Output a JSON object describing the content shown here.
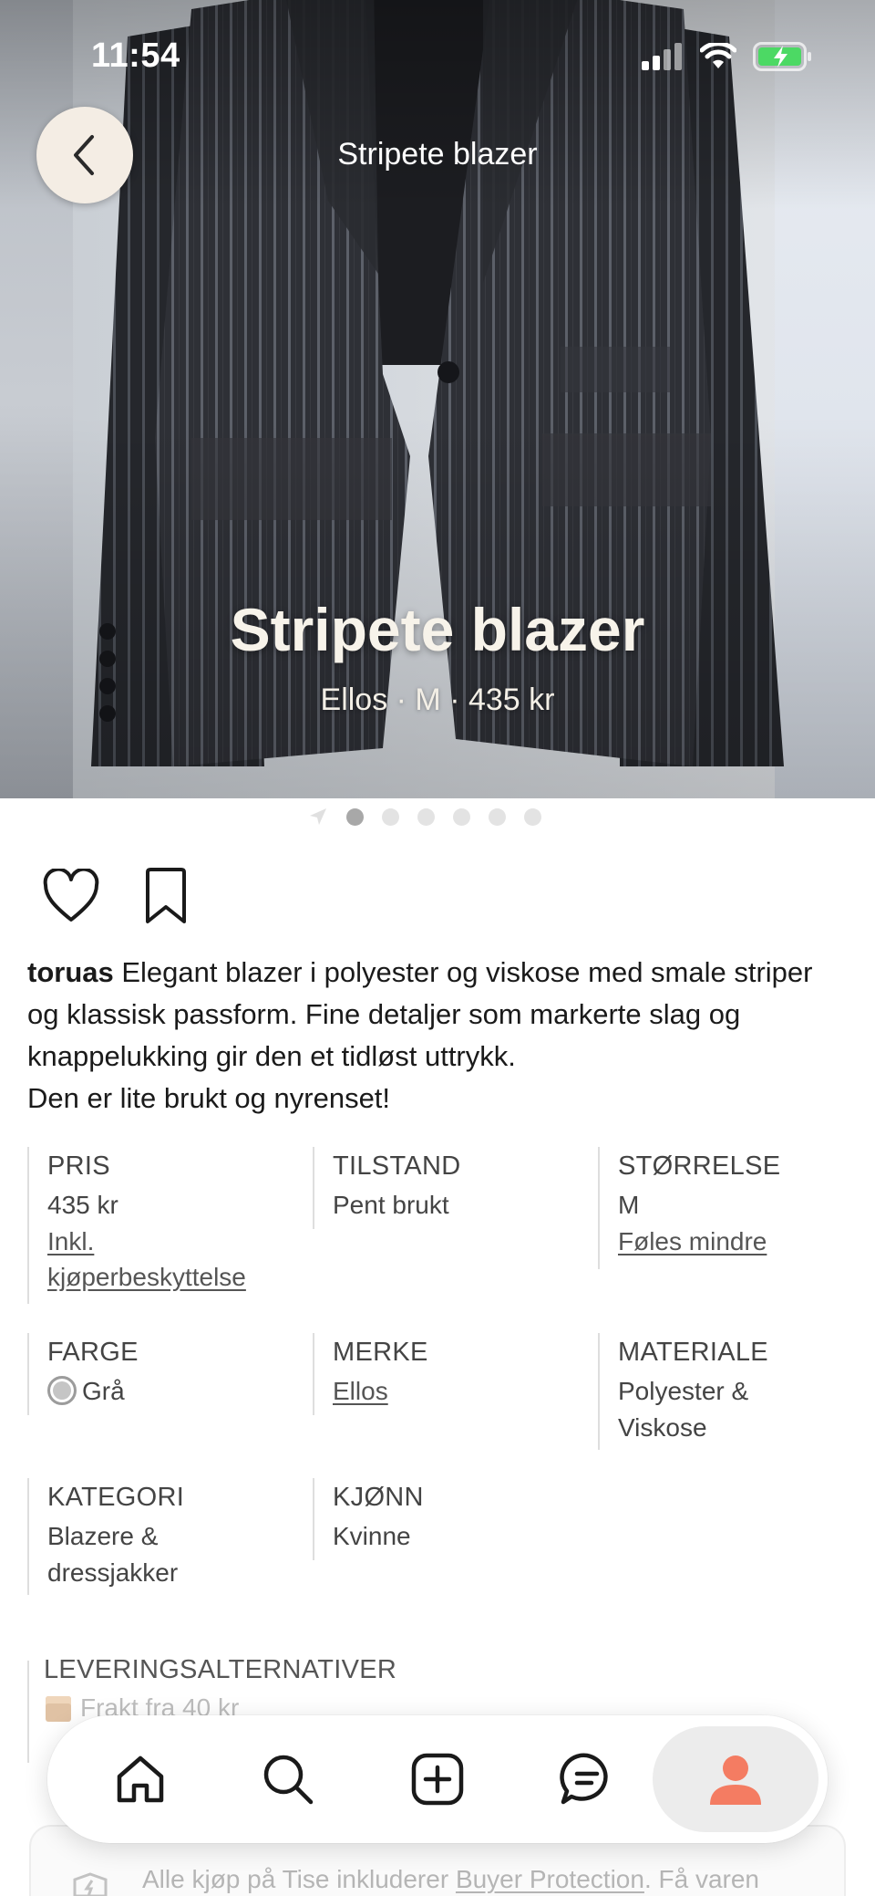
{
  "status_bar": {
    "time": "11:54"
  },
  "header": {
    "title": "Stripete blazer"
  },
  "hero": {
    "title": "Stripete blazer",
    "subtitle": "Ellos · M · 435 kr",
    "image_count": 6,
    "active_index": 1
  },
  "description": {
    "username": "toruas",
    "text": " Elegant blazer i polyester og viskose med smale striper og klassisk passform. Fine detaljer som markerte slag og knappelukking gir den et tidløst uttrykk.",
    "text2": "Den er lite brukt og nyrenset!"
  },
  "details": {
    "price": {
      "label": "PRIS",
      "value": "435 kr",
      "link": "Inkl. kjøperbeskyttelse"
    },
    "condition": {
      "label": "TILSTAND",
      "value": "Pent brukt"
    },
    "size": {
      "label": "STØRRELSE",
      "value": "M",
      "link": "Føles mindre"
    },
    "color": {
      "label": "FARGE",
      "value": "Grå",
      "swatch": "#c5c5c5"
    },
    "brand": {
      "label": "MERKE",
      "value": "Ellos"
    },
    "material": {
      "label": "MATERIALE",
      "value": "Polyester & Viskose"
    },
    "category": {
      "label": "KATEGORI",
      "value": "Blazere & dressjakker"
    },
    "gender": {
      "label": "KJØNN",
      "value": "Kvinne"
    }
  },
  "delivery": {
    "label": "LEVERINGSALTERNATIVER",
    "option": "Frakt fra 40 kr"
  },
  "tabbar": {
    "items": [
      {
        "name": "home-icon"
      },
      {
        "name": "search-icon"
      },
      {
        "name": "add-icon"
      },
      {
        "name": "messages-icon"
      },
      {
        "name": "profile-icon"
      }
    ],
    "active": "profile-icon",
    "accent": "#f47c62"
  },
  "footer": {
    "text_before": "Alle kjøp på Tise inkluderer ",
    "link": "Buyer Protection",
    "text_after": ". Få varen"
  }
}
